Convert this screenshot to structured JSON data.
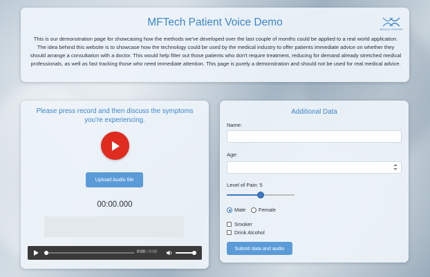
{
  "header": {
    "title": "MFTech Patient Voice Demo",
    "description": "This is our demonstration page for showcasing how the methods we've developed over the last couple of months could be applied to a real world application. The idea behind this website is to showcase how the technology could be used by the medical industry to offer patients immediate advice on whether they should arrange a consultation with a doctor. This would help filter out those patients who don't require treatment, reducing for demand already stretched medical professionals, as well as fast tracking those who need immediate attention. This page is purely a demonstration and should not be used for real medical advice.",
    "logo_text": "MEDICAL FRONTIER"
  },
  "recorder": {
    "prompt": "Please press record and then discuss the symptoms you're experiencing.",
    "record_icon": "play-icon",
    "upload_label": "Upload Audio file",
    "timer": "00:00.000",
    "player": {
      "current_time": "0:00",
      "separator": "/",
      "duration": "0:00",
      "volume_icon": "volume-icon"
    }
  },
  "form": {
    "heading": "Additional Data",
    "name_label": "Name:",
    "name_value": "",
    "age_label": "Age:",
    "age_value": "",
    "pain_label": "Level of Pain: 5",
    "pain_level": 5,
    "pain_max": 10,
    "gender_options": [
      "Male",
      "Female"
    ],
    "gender_selected": "Male",
    "smoker_label": "Smoker",
    "alcohol_label": "Drink Alcohol",
    "submit_label": "Submit data and audio"
  },
  "colors": {
    "accent": "#3d86c6",
    "button": "#5b9bd8",
    "record": "#e02b1f"
  }
}
